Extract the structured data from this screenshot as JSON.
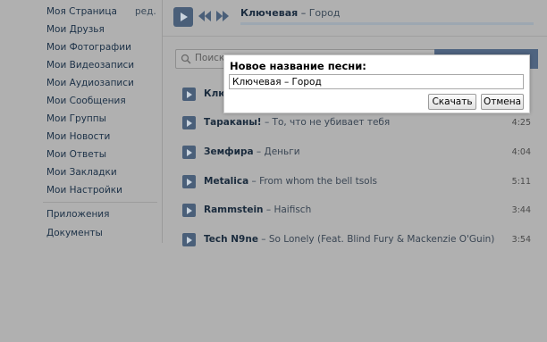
{
  "sidebar": {
    "edit_label": "ред.",
    "items": [
      {
        "label": "Моя Страница"
      },
      {
        "label": "Мои Друзья"
      },
      {
        "label": "Мои Фотографии"
      },
      {
        "label": "Мои Видеозаписи"
      },
      {
        "label": "Мои Аудиозаписи"
      },
      {
        "label": "Мои Сообщения"
      },
      {
        "label": "Мои Группы"
      },
      {
        "label": "Мои Новости"
      },
      {
        "label": "Мои Ответы"
      },
      {
        "label": "Мои Закладки"
      },
      {
        "label": "Мои Настройки"
      }
    ],
    "extra_items": [
      {
        "label": "Приложения"
      },
      {
        "label": "Документы"
      }
    ]
  },
  "player": {
    "artist": "Ключевая",
    "separator": " – ",
    "title": "Город",
    "progress": 0.0
  },
  "search": {
    "placeholder": "Поиск"
  },
  "tracks": [
    {
      "artist": "Ключевая",
      "title": "",
      "duration": "",
      "separator": ""
    },
    {
      "artist": "Тараканы!",
      "separator": " – ",
      "title": "То, что не убивает тебя",
      "duration": "4:25"
    },
    {
      "artist": "Земфира",
      "separator": " – ",
      "title": "Деньги",
      "duration": "4:04"
    },
    {
      "artist": "Metalica",
      "separator": " – ",
      "title": "From whom the bell tsols",
      "duration": "5:11"
    },
    {
      "artist": "Rammstein",
      "separator": " – ",
      "title": "Haifisch",
      "duration": "3:44"
    },
    {
      "artist": "Tech N9ne",
      "separator": " – ",
      "title": "So Lonely (Feat. Blind Fury & Mackenzie O'Guin)",
      "duration": "3:54"
    }
  ],
  "dialog": {
    "title": "Новое название песни:",
    "input_value": "Ключевая – Город",
    "download_label": "Скачать",
    "cancel_label": "Отмена"
  },
  "colors": {
    "overlay_bg": "#b0b0b0",
    "accent": "#4a5f79",
    "link": "#1c3147"
  }
}
